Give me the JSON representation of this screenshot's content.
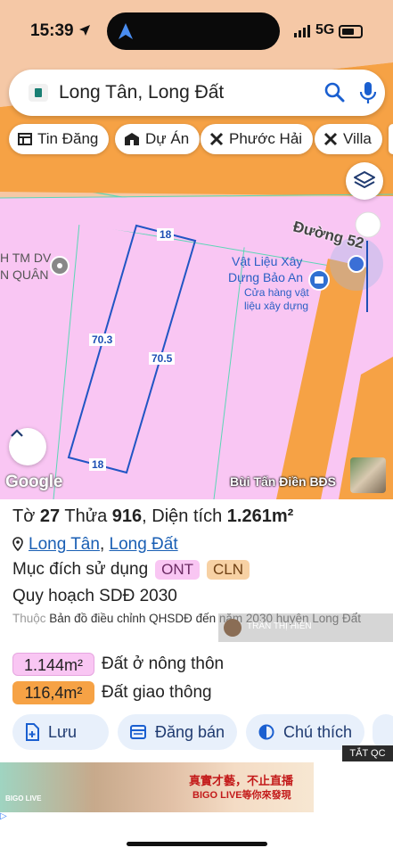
{
  "status": {
    "time": "15:39",
    "network": "5G"
  },
  "search": {
    "query": "Long Tân, Long Đất"
  },
  "chips": [
    {
      "label": "Tin Đăng",
      "icon": "list-icon"
    },
    {
      "label": "Dự Án",
      "icon": "building-icon"
    },
    {
      "label": "Phước Hải",
      "icon": "cross-tools-icon"
    },
    {
      "label": "Villa",
      "icon": "cross-tools-icon"
    }
  ],
  "map": {
    "road_label": "Đường 52",
    "poi_left_1": "H TM DV",
    "poi_left_2": "N QUÂN",
    "poi_name_1": "Vật Liệu Xây",
    "poi_name_2": "Dựng Bảo An",
    "poi_sub_1": "Cửa hàng vật",
    "poi_sub_2": "liệu xây dựng",
    "dim_top": "18",
    "dim_bottom": "18",
    "dim_left": "70.3",
    "dim_right": "70.5",
    "google": "Google",
    "watermark": "Bùi Tấn Điền BĐS"
  },
  "parcel": {
    "to_label": "Tờ",
    "to_value": "27",
    "thua_label": "Thửa",
    "thua_value": "916",
    "area_label": "Diện tích",
    "area_value": "1.261m²",
    "ward": "Long Tân",
    "district": "Long Đất",
    "purpose_label": "Mục đích sử dụng",
    "purpose_tags": [
      "ONT",
      "CLN"
    ],
    "plan_label": "Quy hoạch SDĐ 2030",
    "desc_prefix": "Thuộc",
    "desc_text": "Bản đồ điều chỉnh QHSDĐ đến năm 2030 huyện Long Đất",
    "overlay_name": "TRẦN THỊ HIÊN",
    "areas": [
      {
        "value": "1.144m²",
        "label": "Đất ở nông thôn"
      },
      {
        "value": "116,4m²",
        "label": "Đất giao thông"
      }
    ]
  },
  "actions": {
    "save": "Lưu",
    "sell": "Đăng bán",
    "note": "Chú thích"
  },
  "ad": {
    "close_label": "TẮT QC",
    "text": "真實才藝，不止直播",
    "subtext": "BIGO LIVE等你來發現",
    "brand": "BIGO LIVE"
  },
  "colors": {
    "pink_zone": "#f9c6f3",
    "orange_road": "#f6a245",
    "link": "#1a5fb4",
    "button_bg": "#e8f0fb"
  }
}
